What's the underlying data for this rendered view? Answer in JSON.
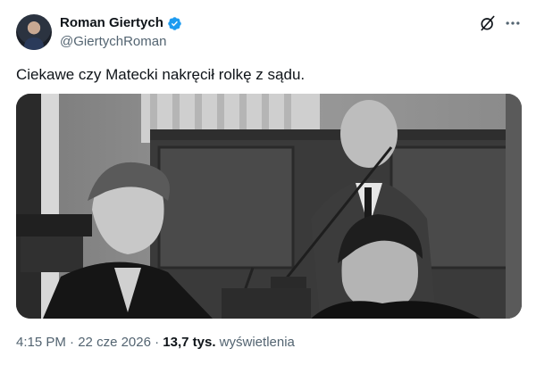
{
  "author": {
    "name": "Roman Giertych",
    "handle": "@GiertychRoman"
  },
  "icons": {
    "verified": "verified-badge-icon",
    "grok": "grok-icon",
    "more": "more-icon",
    "avatar": "avatar"
  },
  "colors": {
    "verified": "#1d9bf0",
    "secondary_text": "#536471",
    "primary_text": "#0f1419"
  },
  "tweet": {
    "text": "Ciekawe czy Matecki nakręcił rolkę z sądu."
  },
  "meta": {
    "time": "4:15 PM",
    "sep1": " · ",
    "date": "22 cze 2026",
    "sep2": " · ",
    "views_count": "13,7 tys.",
    "views_label": " wyświetlenia"
  }
}
